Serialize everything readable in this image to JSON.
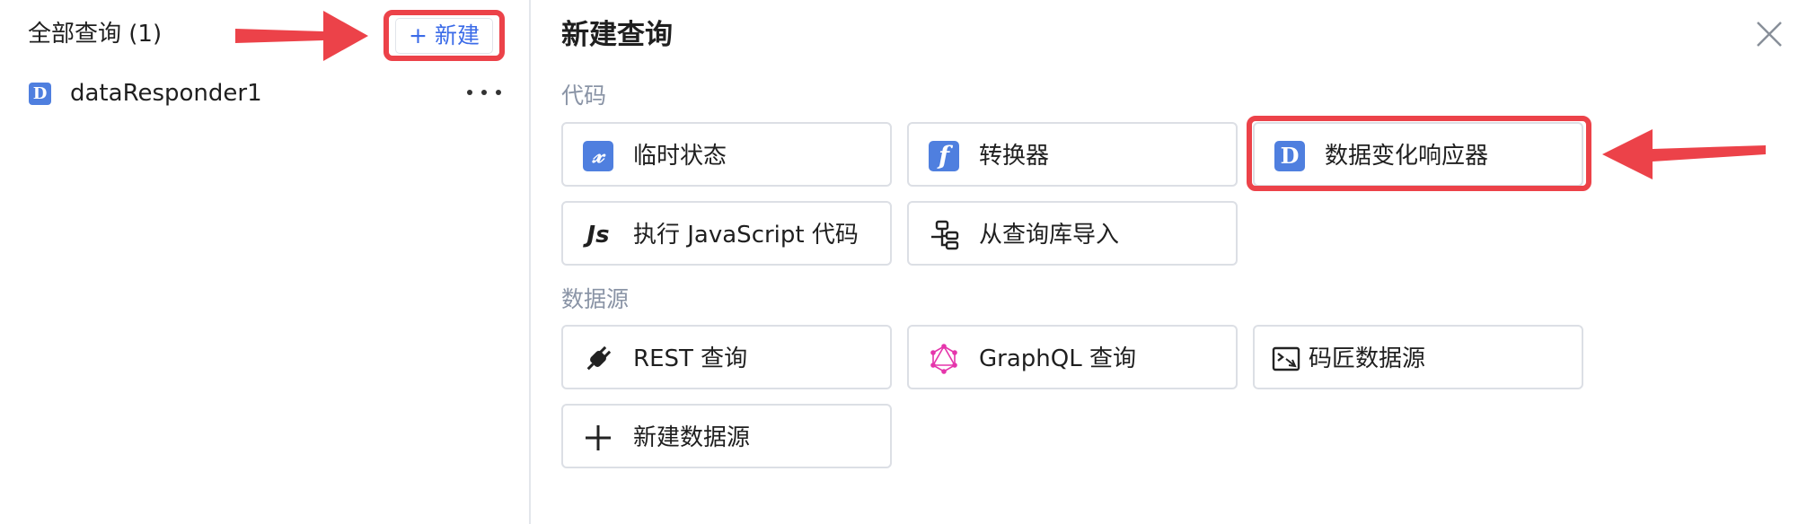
{
  "left": {
    "title": "全部查询 (1)",
    "new_button": "+ 新建",
    "queries": [
      {
        "icon": "data-responder-icon",
        "icon_letter": "D",
        "name": "dataResponder1"
      }
    ]
  },
  "right": {
    "title": "新建查询",
    "sections": [
      {
        "label": "代码",
        "cards": [
          {
            "icon": "temp-state-icon",
            "glyph": "𝓍",
            "label": "临时状态"
          },
          {
            "icon": "transformer-icon",
            "glyph": "f",
            "label": "转换器"
          },
          {
            "icon": "data-responder-icon",
            "glyph": "D",
            "label": "数据变化响应器"
          },
          {
            "icon": "javascript-icon",
            "glyph": "Js",
            "label": "执行 JavaScript 代码"
          },
          {
            "icon": "query-library-icon",
            "glyph": "",
            "label": "从查询库导入"
          }
        ]
      },
      {
        "label": "数据源",
        "cards": [
          {
            "icon": "rest-plug-icon",
            "glyph": "",
            "label": "REST 查询"
          },
          {
            "icon": "graphql-icon",
            "glyph": "",
            "label": "GraphQL 查询"
          },
          {
            "icon": "mj-datasource-icon",
            "glyph": "",
            "label": "码匠数据源"
          },
          {
            "icon": "plus-icon",
            "glyph": "",
            "label": "新建数据源"
          }
        ]
      }
    ]
  },
  "colors": {
    "accent": "#3b6be8",
    "icon_blue": "#4f7fdf",
    "highlight_red": "#ec4249",
    "graphql_pink": "#e535ab",
    "muted_text": "#8a94a6"
  }
}
